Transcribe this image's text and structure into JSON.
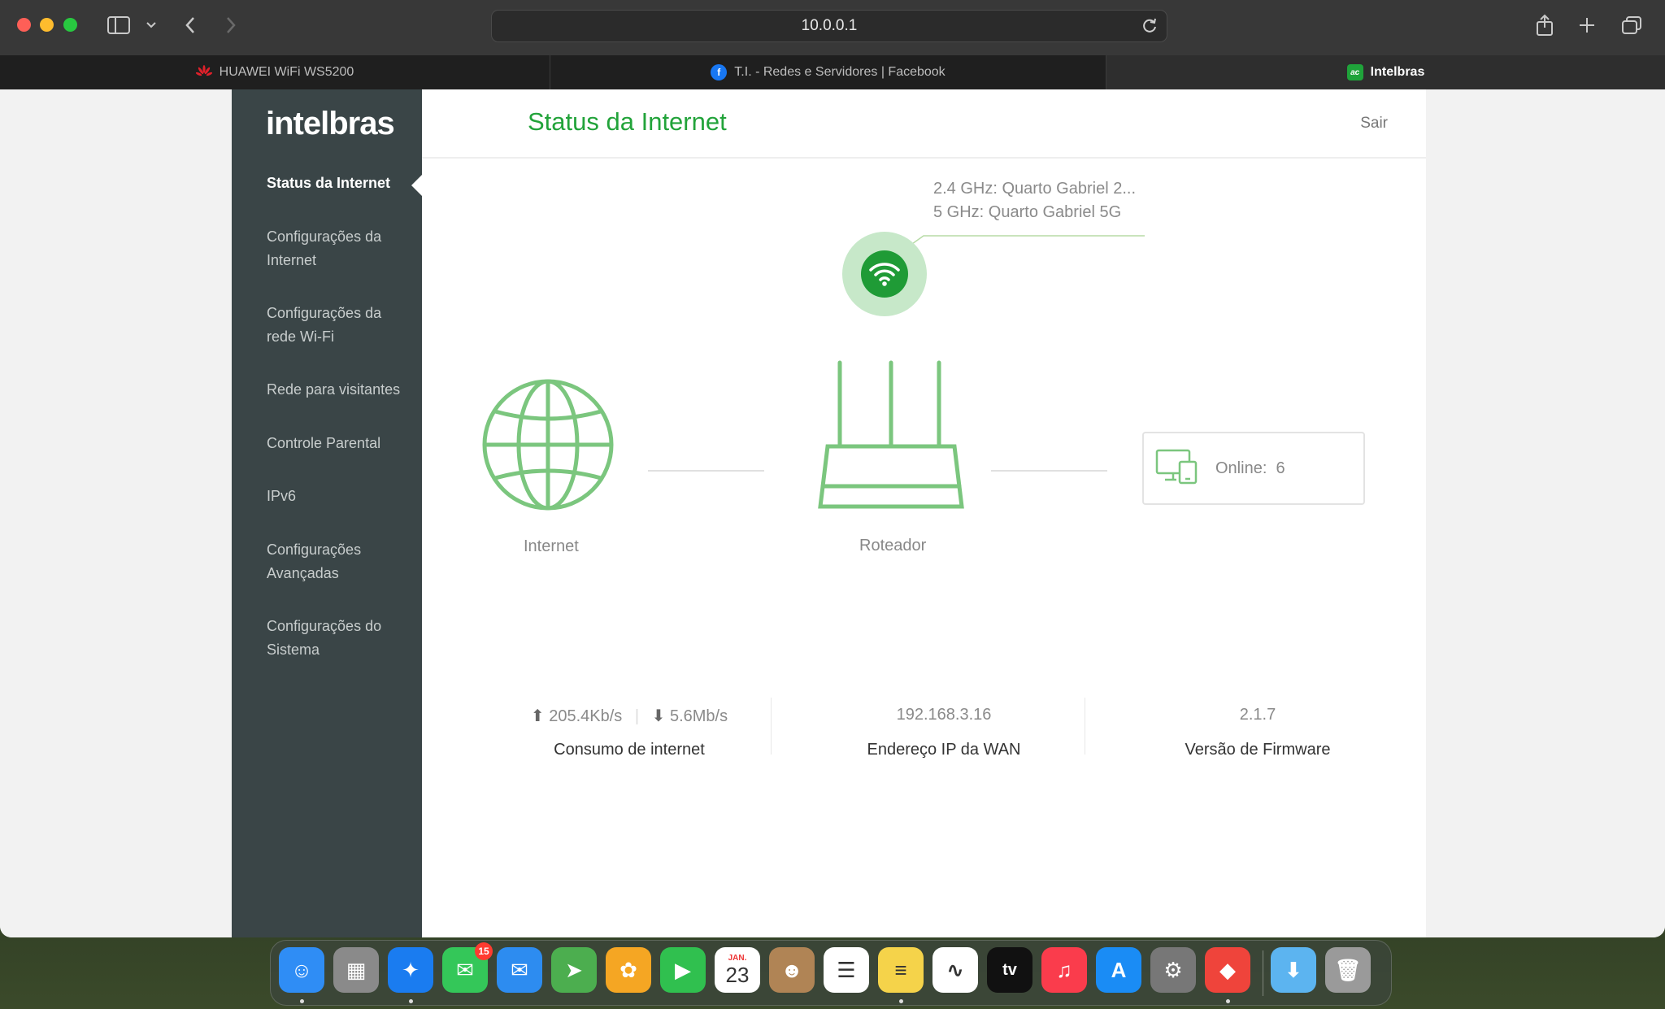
{
  "browser": {
    "url": "10.0.0.1",
    "tabs": [
      {
        "label": "HUAWEI WiFi WS5200",
        "active": false
      },
      {
        "label": "T.I. - Redes e Servidores | Facebook",
        "active": false
      },
      {
        "label": "Intelbras",
        "active": true
      }
    ]
  },
  "app": {
    "logo": "intelbras",
    "page_title": "Status da Internet",
    "logout": "Sair"
  },
  "sidebar": {
    "items": [
      {
        "label": "Status da Internet",
        "active": true
      },
      {
        "label": "Configurações da Internet",
        "active": false
      },
      {
        "label": "Configurações da rede Wi-Fi",
        "active": false
      },
      {
        "label": "Rede para visitantes",
        "active": false
      },
      {
        "label": "Controle Parental",
        "active": false
      },
      {
        "label": "IPv6",
        "active": false
      },
      {
        "label": "Configurações Avançadas",
        "active": false
      },
      {
        "label": "Configurações do Sistema",
        "active": false
      }
    ]
  },
  "topology": {
    "wifi_24": "2.4 GHz: Quarto Gabriel 2...",
    "wifi_5": "5 GHz: Quarto Gabriel 5G",
    "internet_label": "Internet",
    "router_label": "Roteador",
    "online_label": "Online:",
    "online_count": "6"
  },
  "stats": {
    "upload": "205.4Kb/s",
    "download": "5.6Mb/s",
    "consumption_label": "Consumo de internet",
    "wan_ip": "192.168.3.16",
    "wan_label": "Endereço IP da WAN",
    "firmware": "2.1.7",
    "firmware_label": "Versão de Firmware"
  },
  "colors": {
    "accent_green": "#22a33a",
    "illustration_green": "#7bc67e",
    "sidebar_bg": "#3a4547"
  },
  "dock": {
    "apps": [
      {
        "name": "finder-icon",
        "color": "#2f8df5",
        "glyph": "☺"
      },
      {
        "name": "launchpad-icon",
        "color": "#8a8a8a",
        "glyph": "▦"
      },
      {
        "name": "safari-icon",
        "color": "#1a7cf0",
        "glyph": "✦"
      },
      {
        "name": "messages-icon",
        "color": "#34c759",
        "glyph": "✉",
        "badge": "15"
      },
      {
        "name": "mail-icon",
        "color": "#2d8cf0",
        "glyph": "✉"
      },
      {
        "name": "maps-icon",
        "color": "#4cae4f",
        "glyph": "➤"
      },
      {
        "name": "photos-icon",
        "color": "#f5a623",
        "glyph": "✿"
      },
      {
        "name": "facetime-icon",
        "color": "#30c04f",
        "glyph": "▶"
      },
      {
        "name": "calendar-icon",
        "color": "#ffffff",
        "glyph": "23",
        "month": "JAN."
      },
      {
        "name": "contacts-icon",
        "color": "#b08455",
        "glyph": "☻"
      },
      {
        "name": "reminders-icon",
        "color": "#ffffff",
        "glyph": "☰"
      },
      {
        "name": "notes-icon",
        "color": "#f5d34a",
        "glyph": "≡"
      },
      {
        "name": "freeform-icon",
        "color": "#ffffff",
        "glyph": "∿"
      },
      {
        "name": "tv-icon",
        "color": "#111111",
        "glyph": "tv"
      },
      {
        "name": "music-icon",
        "color": "#fa3c4c",
        "glyph": "♫"
      },
      {
        "name": "app-store-icon",
        "color": "#1a8cf5",
        "glyph": "A"
      },
      {
        "name": "system-settings-icon",
        "color": "#777777",
        "glyph": "⚙"
      },
      {
        "name": "anydesk-icon",
        "color": "#ef443b",
        "glyph": "◆"
      },
      {
        "name": "downloads-folder-icon",
        "color": "#5cb4f0",
        "glyph": "⬇"
      },
      {
        "name": "trash-icon",
        "color": "#9a9a9a",
        "glyph": "🗑"
      }
    ]
  }
}
